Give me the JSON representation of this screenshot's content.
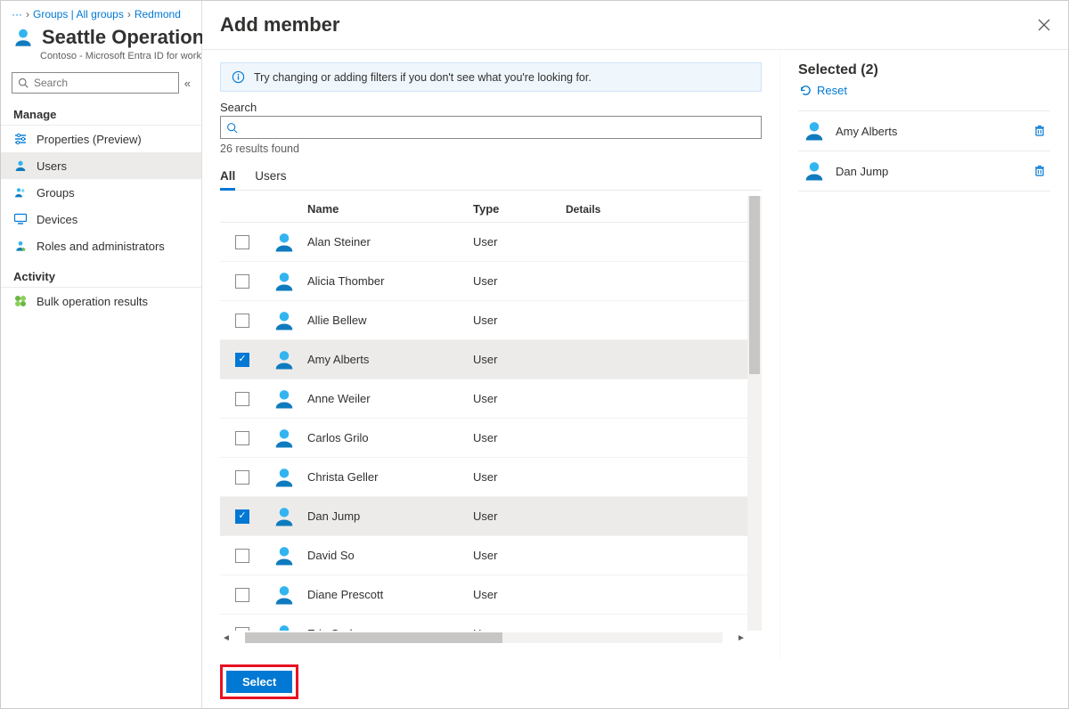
{
  "breadcrumb": {
    "ellipsis": "···",
    "groups": "Groups | All groups",
    "redmond": "Redmond"
  },
  "header": {
    "title": "Seattle Operations",
    "subtitle": "Contoso - Microsoft Entra ID for workforce"
  },
  "search": {
    "placeholder": "Search"
  },
  "sections": {
    "manage": "Manage",
    "activity": "Activity"
  },
  "nav": {
    "properties": "Properties (Preview)",
    "users": "Users",
    "groups": "Groups",
    "devices": "Devices",
    "roles": "Roles and administrators",
    "bulk": "Bulk operation results"
  },
  "modal": {
    "title": "Add member",
    "info": "Try changing or adding filters if you don't see what you're looking for.",
    "search_label": "Search",
    "results_found": "26 results found",
    "tabs": {
      "all": "All",
      "users": "Users"
    },
    "columns": {
      "name": "Name",
      "type": "Type",
      "details": "Details"
    },
    "rows": [
      {
        "name": "Alan Steiner",
        "type": "User",
        "checked": false
      },
      {
        "name": "Alicia Thomber",
        "type": "User",
        "checked": false
      },
      {
        "name": "Allie Bellew",
        "type": "User",
        "checked": false
      },
      {
        "name": "Amy Alberts",
        "type": "User",
        "checked": true
      },
      {
        "name": "Anne Weiler",
        "type": "User",
        "checked": false
      },
      {
        "name": "Carlos Grilo",
        "type": "User",
        "checked": false
      },
      {
        "name": "Christa Geller",
        "type": "User",
        "checked": false
      },
      {
        "name": "Dan Jump",
        "type": "User",
        "checked": true
      },
      {
        "name": "David So",
        "type": "User",
        "checked": false
      },
      {
        "name": "Diane Prescott",
        "type": "User",
        "checked": false
      },
      {
        "name": "Eric Gruber",
        "type": "User",
        "checked": false
      }
    ],
    "select_button": "Select"
  },
  "selected": {
    "header": "Selected (2)",
    "reset": "Reset",
    "items": [
      {
        "name": "Amy Alberts"
      },
      {
        "name": "Dan Jump"
      }
    ]
  }
}
